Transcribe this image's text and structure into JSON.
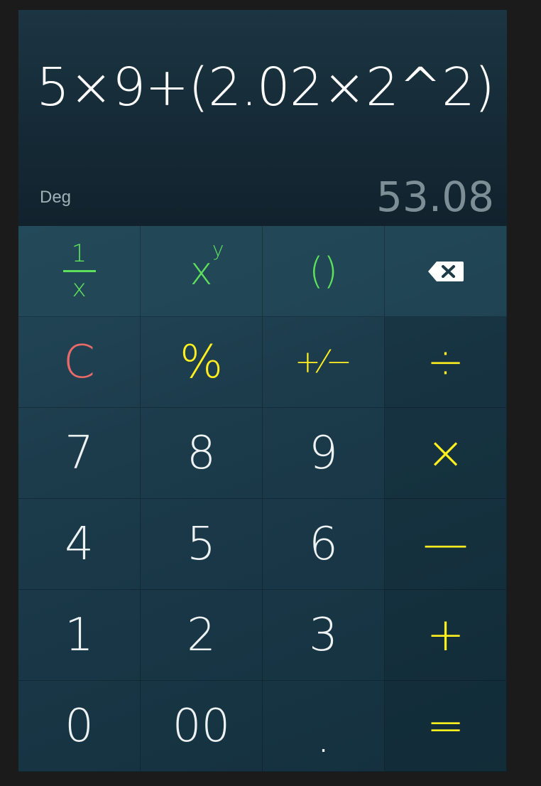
{
  "display": {
    "expression": "5×9+(2.02×2^2)",
    "mode": "Deg",
    "result": "53.08"
  },
  "keys": {
    "reciprocal": {
      "numerator": "1",
      "denominator": "x"
    },
    "power": {
      "base": "x",
      "exponent": "y"
    },
    "parentheses": "()",
    "backspace": "backspace-icon",
    "clear": "C",
    "percent": "%",
    "plus_minus": "+⁄−",
    "divide": "÷",
    "seven": "7",
    "eight": "8",
    "nine": "9",
    "multiply": "×",
    "four": "4",
    "five": "5",
    "six": "6",
    "minus": "—",
    "one": "1",
    "two": "2",
    "three": "3",
    "plus": "+",
    "zero": "0",
    "double_zero": "00",
    "decimal": ".",
    "equals": "="
  },
  "colors": {
    "numbers": "#eef2f3",
    "operators": "#ffef1f",
    "functions": "#5ee05c",
    "clear": "#e86a6a",
    "result": "#7d8e96"
  }
}
